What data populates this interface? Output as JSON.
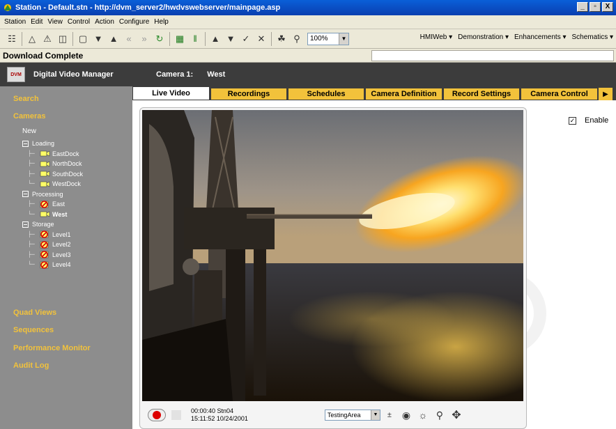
{
  "window": {
    "title": "Station - Default.stn - http://dvm_server2/hwdvswebserver/mainpage.asp",
    "controls": [
      "_",
      "▫",
      "X"
    ]
  },
  "menubar": [
    "Station",
    "Edit",
    "View",
    "Control",
    "Action",
    "Configure",
    "Help"
  ],
  "toolbar": {
    "zoom": "100%",
    "menus": [
      "HMIWeb ▾",
      "Demonstration ▾",
      "Enhancements ▾",
      "Schematics ▾"
    ]
  },
  "status": {
    "message": "Download Complete"
  },
  "sidebar": {
    "app_title": "Digital Video Manager",
    "logo_text": "DVM",
    "search": "Search",
    "cameras": "Cameras",
    "new": "New",
    "groups": [
      {
        "label": "Loading",
        "items": [
          {
            "label": "EastDock",
            "state": "ok"
          },
          {
            "label": "NorthDock",
            "state": "ok"
          },
          {
            "label": "SouthDock",
            "state": "ok"
          },
          {
            "label": "WestDock",
            "state": "ok"
          }
        ]
      },
      {
        "label": "Processing",
        "items": [
          {
            "label": "East",
            "state": "alarm"
          },
          {
            "label": "West",
            "state": "ok"
          }
        ]
      },
      {
        "label": "Storage",
        "items": [
          {
            "label": "Level1",
            "state": "alarm"
          },
          {
            "label": "Level2",
            "state": "alarm"
          },
          {
            "label": "Level3",
            "state": "alarm"
          },
          {
            "label": "Level4",
            "state": "alarm"
          }
        ]
      }
    ],
    "quad_views": "Quad Views",
    "sequences": "Sequences",
    "performance_monitor": "Performance Monitor",
    "audit_log": "Audit Log"
  },
  "camera": {
    "label": "Camera 1:",
    "name": "West"
  },
  "tabs": [
    "Live Video",
    "Recordings",
    "Schedules",
    "Camera Definition",
    "Record Settings",
    "Camera Control"
  ],
  "enable": {
    "label": "Enable",
    "checked": true
  },
  "playback": {
    "elapsed": "00:00:40 Stn04",
    "timestamp": "15:11:52 10/24/2001",
    "area": "TestingArea"
  },
  "colors": {
    "accent": "#f2c23b",
    "sidebar": "#8d8d8d",
    "header": "#3c3c3c"
  }
}
